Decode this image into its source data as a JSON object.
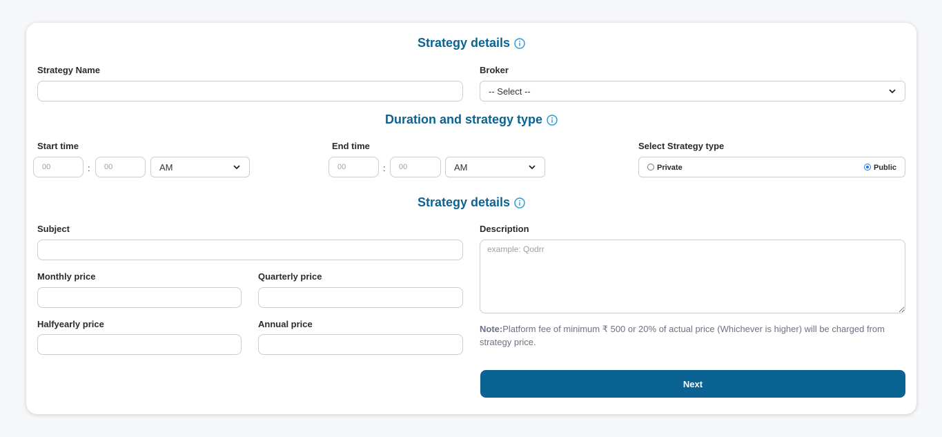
{
  "section1": {
    "title": "Strategy details"
  },
  "strategy_name": {
    "label": "Strategy Name",
    "value": "",
    "placeholder": ""
  },
  "broker": {
    "label": "Broker",
    "selected": "-- Select --"
  },
  "section2": {
    "title": "Duration and strategy type"
  },
  "start_time": {
    "label": "Start time",
    "hour_placeholder": "00",
    "minute_placeholder": "00",
    "separator": ":",
    "period": "AM"
  },
  "end_time": {
    "label": "End time",
    "hour_placeholder": "00",
    "minute_placeholder": "00",
    "separator": ":",
    "period": "AM"
  },
  "strategy_type": {
    "label": "Select Strategy type",
    "options": [
      "Private",
      "Public"
    ],
    "selected": "Public"
  },
  "section3": {
    "title": "Strategy details"
  },
  "subject": {
    "label": "Subject",
    "value": ""
  },
  "monthly_price": {
    "label": "Monthly price",
    "value": ""
  },
  "quarterly_price": {
    "label": "Quarterly price",
    "value": ""
  },
  "halfyearly_price": {
    "label": "Halfyearly price",
    "value": ""
  },
  "annual_price": {
    "label": "Annual price",
    "value": ""
  },
  "description": {
    "label": "Description",
    "placeholder": "example: Qodrr"
  },
  "note": {
    "prefix": "Note:",
    "text": "Platform fee of minimum ₹ 500 or 20% of actual price (Whichever is higher) will be charged from strategy price."
  },
  "next_button": {
    "label": "Next"
  },
  "colors": {
    "accent": "#0b6394",
    "radio": "#1a73e8",
    "info_icon": "#1e9bd7"
  },
  "icons": {
    "info": "info-circle-icon",
    "chevron": "chevron-down-icon"
  }
}
